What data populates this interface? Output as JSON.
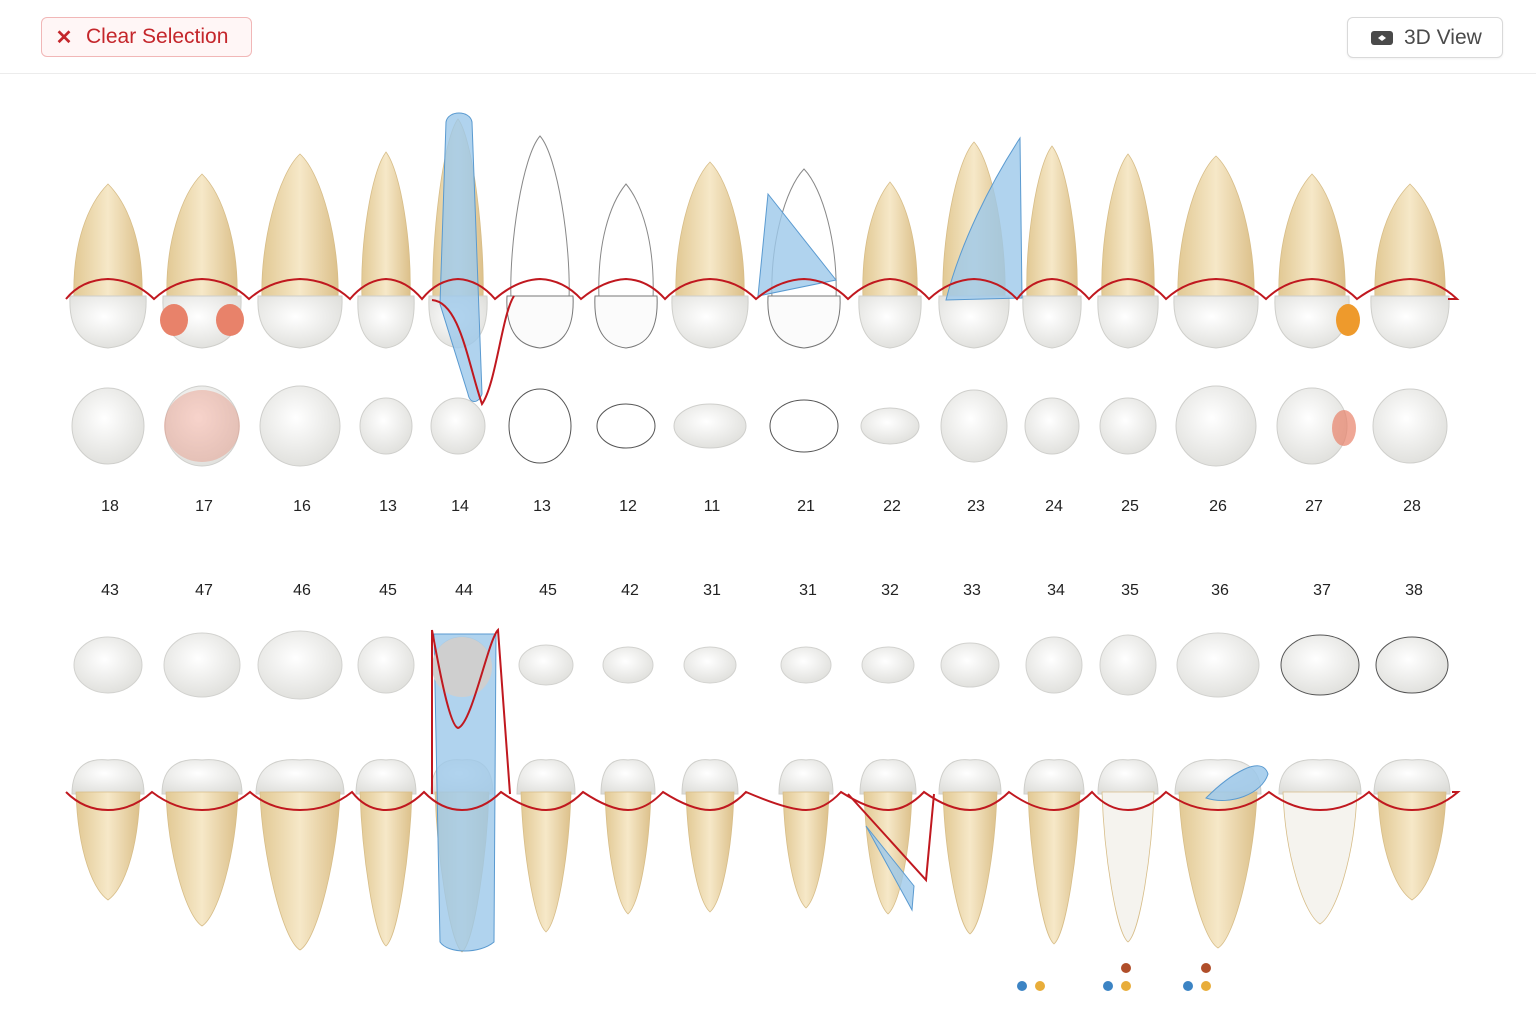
{
  "toolbar": {
    "clear_label": "Clear Selection",
    "clear_icon": "close-icon",
    "view3d_label": "3D View",
    "view3d_icon": "cube-icon"
  },
  "upper_numbers": [
    "18",
    "17",
    "16",
    "13",
    "14",
    "13",
    "12",
    "11",
    "21",
    "22",
    "23",
    "24",
    "25",
    "26",
    "27",
    "28"
  ],
  "lower_numbers": [
    "43",
    "47",
    "46",
    "45",
    "44",
    "45",
    "42",
    "31",
    "31",
    "32",
    "33",
    "34",
    "35",
    "36",
    "37",
    "38"
  ],
  "colors": {
    "gum_line": "#c0181f",
    "root": "#ecd9b0",
    "crown": "#f4f4f2",
    "selected": "#9cc8ea",
    "caries": "#e8826a",
    "filling": "#ee9a2c",
    "dot_blue": "#3c84c4",
    "dot_yellow": "#e8ad3a",
    "dot_brown": "#b04e2a"
  },
  "markers": [
    {
      "tooth": "34",
      "dots": [
        "dot_blue",
        "dot_yellow"
      ]
    },
    {
      "tooth": "35",
      "dots": [
        "dot_brown",
        "dot_blue",
        "dot_yellow"
      ]
    },
    {
      "tooth": "36",
      "dots": [
        "dot_brown",
        "dot_blue",
        "dot_yellow"
      ]
    }
  ]
}
